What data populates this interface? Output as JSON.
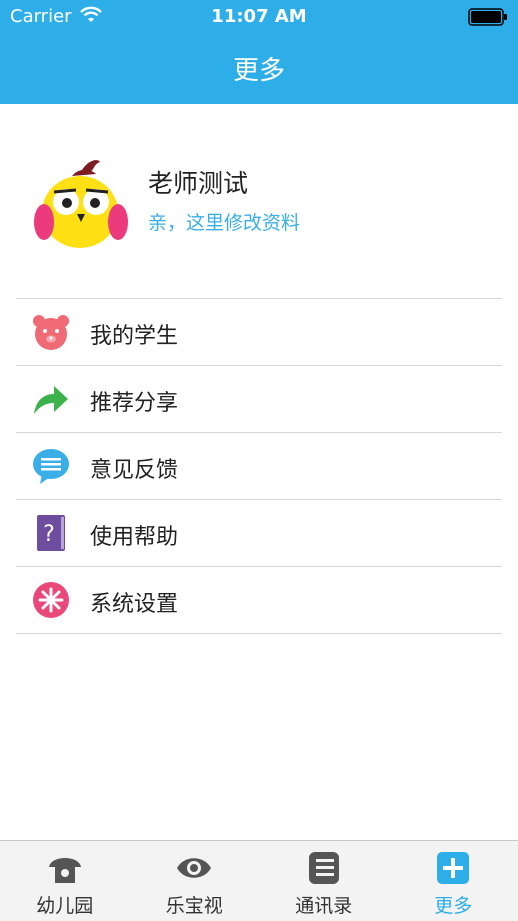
{
  "status_bar": {
    "carrier": "Carrier",
    "time": "11:07 AM"
  },
  "nav": {
    "title": "更多"
  },
  "profile": {
    "name": "老师测试",
    "subtitle": "亲，这里修改资料"
  },
  "menu": [
    {
      "label": "我的学生",
      "icon": "bear-icon"
    },
    {
      "label": "推荐分享",
      "icon": "share-arrow-icon"
    },
    {
      "label": "意见反馈",
      "icon": "chat-bubble-icon"
    },
    {
      "label": "使用帮助",
      "icon": "help-book-icon"
    },
    {
      "label": "系统设置",
      "icon": "settings-asterisk-icon"
    }
  ],
  "tabs": [
    {
      "label": "幼儿园",
      "icon": "kindergarten-icon",
      "active": false
    },
    {
      "label": "乐宝视",
      "icon": "eye-icon",
      "active": false
    },
    {
      "label": "通讯录",
      "icon": "contacts-icon",
      "active": false
    },
    {
      "label": "更多",
      "icon": "plus-icon",
      "active": true
    }
  ],
  "colors": {
    "accent": "#2eaee9",
    "tab_inactive": "#555555"
  }
}
